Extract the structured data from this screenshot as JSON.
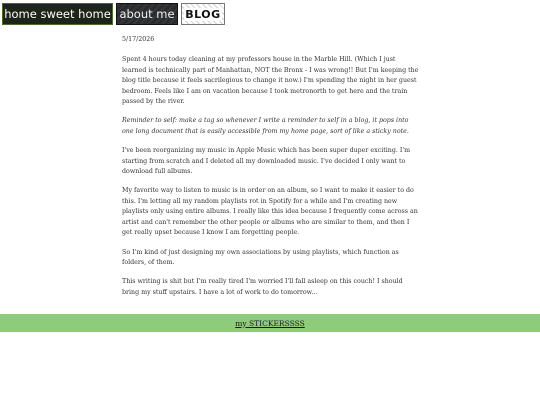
{
  "nav": {
    "home_label": "home sweet home",
    "about_label": "about me",
    "blog_label": "BLOG"
  },
  "post": {
    "date": "5/17/2026",
    "paragraphs": [
      "Spent 4 hours today cleaning at my professors house in the Marble Hill. (Which I just learned is technically part of Manhattan, NOT the Bronx - I was wrong!! But I'm keeping the blog title because it feels sacrilegious to change it now.) I'm spending the night in her guest bedroom. Feels like I am on vacation because I took metronorth to get here and the train passed by the river.",
      "Reminder to self: make a tag so whenever I write a reminder to self in a blog, it pops into one long document that is easily accessible from my home page, sort of like a sticky note.",
      "I've been reorganizing my music in Apple Music which has been super duper exciting. I'm starting from scratch and I deleted all my downloaded music. I've decided I only want to download full albums.",
      "My favorite way to listen to music is in order on an album, so I want to make it easier to do this. I'm letting all my random playlists rot in Spotify for a while and I'm creating new playlists only using entire albums. I really like this idea because I frequently come across an artist and can't remember the other people or albums who are similar to them, and then I get really upset because I know I am forgetting people.",
      "So I'm kind of just designing my own associations by using playlists, which function as folders, of them.",
      "This writing is shit but I'm really tired I'm worried I'll fall asleep on this couch! I should bring my stuff upstairs. I have a lot of work to do tomorrow..."
    ]
  },
  "footer": {
    "link_label": "my STICKERSSSS",
    "bar_color": "#8ecb7a"
  }
}
